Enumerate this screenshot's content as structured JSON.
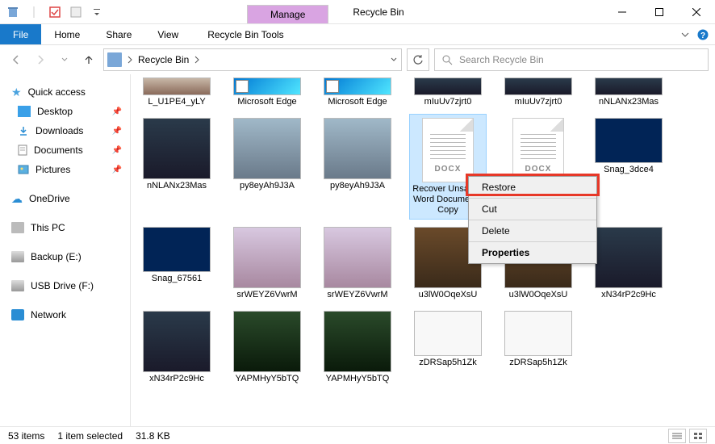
{
  "window": {
    "title": "Recycle Bin",
    "context_tab": "Manage",
    "tools_tab": "Recycle Bin Tools"
  },
  "ribbon": {
    "file": "File",
    "tabs": [
      "Home",
      "Share",
      "View"
    ]
  },
  "address": {
    "crumb": "Recycle Bin",
    "search_placeholder": "Search Recycle Bin"
  },
  "sidebar": {
    "quick_access": "Quick access",
    "pinned": [
      {
        "label": "Desktop"
      },
      {
        "label": "Downloads"
      },
      {
        "label": "Documents"
      },
      {
        "label": "Pictures"
      }
    ],
    "onedrive": "OneDrive",
    "thispc": "This PC",
    "drives": [
      {
        "label": "Backup (E:)"
      },
      {
        "label": "USB Drive (F:)"
      }
    ],
    "network": "Network"
  },
  "items": {
    "row0": [
      {
        "label": "L_U1PE4_yLY"
      },
      {
        "label": "Microsoft Edge"
      },
      {
        "label": "Microsoft Edge"
      },
      {
        "label": "mIuUv7zjrt0"
      },
      {
        "label": "mIuUv7zjrt0"
      },
      {
        "label": "nNLANx23Mas"
      }
    ],
    "row1": [
      {
        "label": "nNLANx23Mas"
      },
      {
        "label": "py8eyAh9J3A"
      },
      {
        "label": "py8eyAh9J3A"
      },
      {
        "label": "Recover Unsaved Word Document - Copy"
      },
      {
        "label": ""
      },
      {
        "label": "Snag_3dce4"
      }
    ],
    "row2": [
      {
        "label": "Snag_67561"
      },
      {
        "label": "srWEYZ6VwrM"
      },
      {
        "label": "srWEYZ6VwrM"
      },
      {
        "label": "u3lW0OqeXsU"
      },
      {
        "label": "u3lW0OqeXsU"
      },
      {
        "label": "xN34rP2c9Hc"
      }
    ],
    "row3": [
      {
        "label": "xN34rP2c9Hc"
      },
      {
        "label": "YAPMHyY5bTQ"
      },
      {
        "label": "YAPMHyY5bTQ"
      },
      {
        "label": "zDRSap5h1Zk"
      },
      {
        "label": "zDRSap5h1Zk"
      }
    ]
  },
  "context_menu": {
    "restore": "Restore",
    "cut": "Cut",
    "delete": "Delete",
    "properties": "Properties"
  },
  "status": {
    "count": "53 items",
    "selection": "1 item selected",
    "size": "31.8 KB"
  },
  "docx_label": "DOCX"
}
